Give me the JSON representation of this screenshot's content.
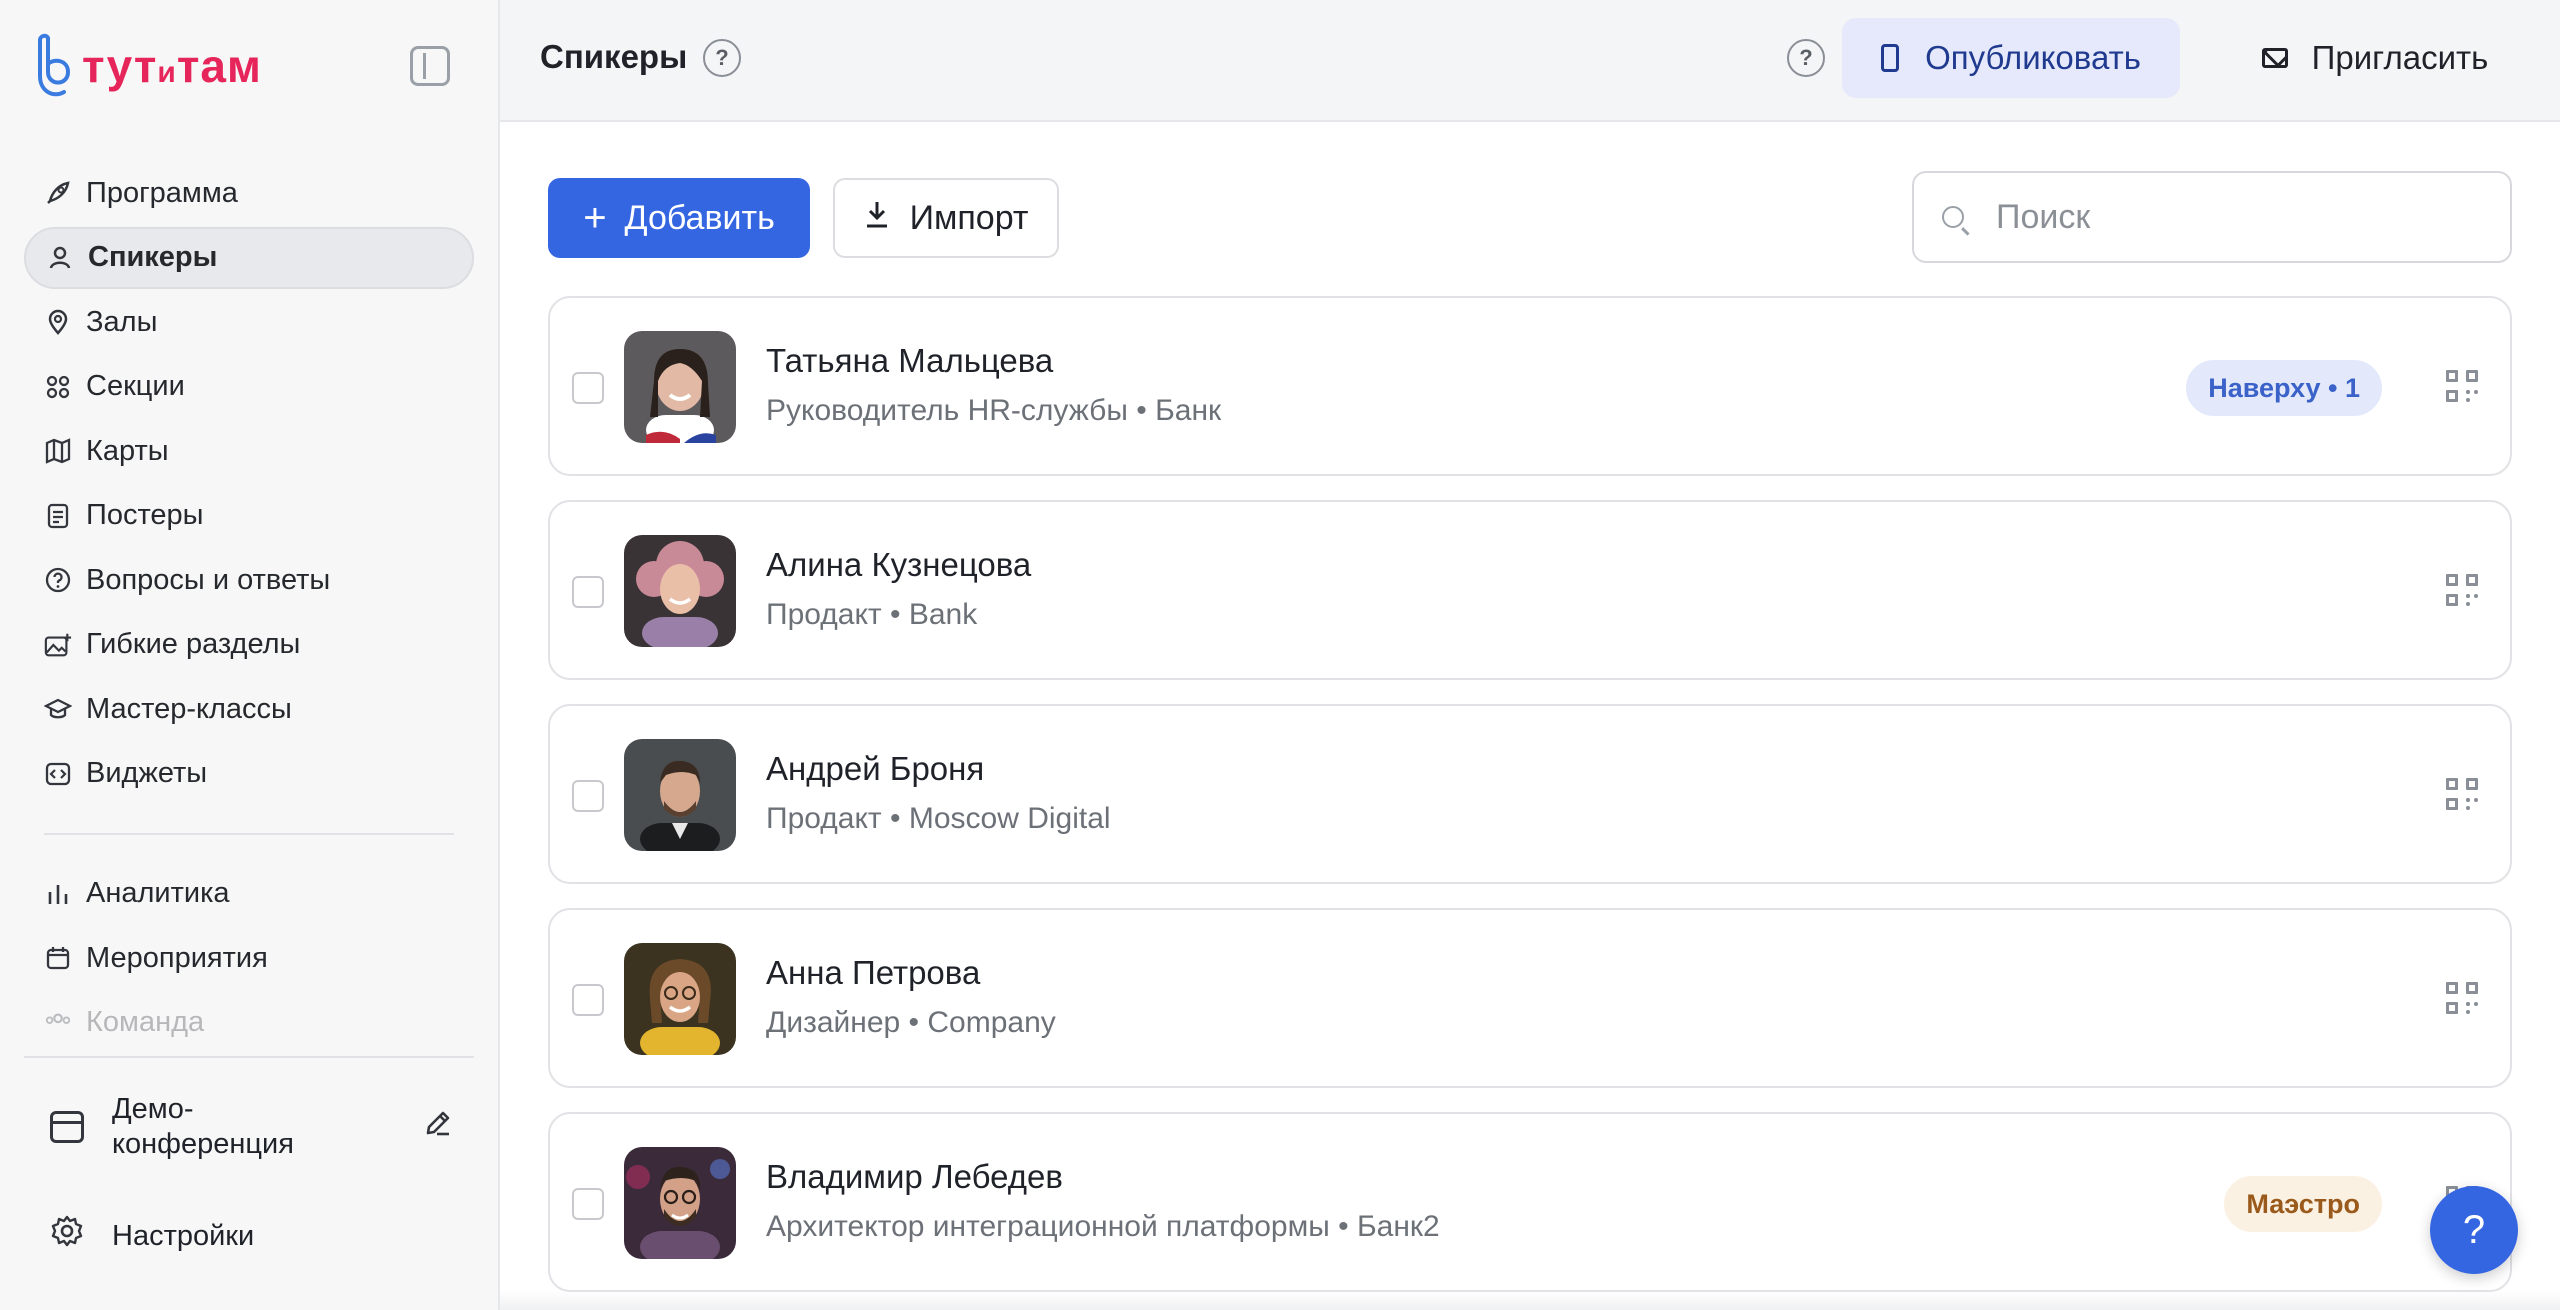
{
  "app": {
    "logo_text_main": "тут",
    "logo_text_small": "и",
    "logo_text_end": "там",
    "brand_color": "#e6265a",
    "accent_color": "#3566e2"
  },
  "sidebar": {
    "items": [
      {
        "label": "Программа",
        "icon": "rocket-icon",
        "glyph": "🚀",
        "active": false
      },
      {
        "label": "Спикеры",
        "icon": "user-icon",
        "glyph": "♙",
        "active": true
      },
      {
        "label": "Залы",
        "icon": "map-pin-icon",
        "glyph": "⌖",
        "active": false
      },
      {
        "label": "Секции",
        "icon": "grid-icon",
        "glyph": "⁘",
        "active": false
      },
      {
        "label": "Карты",
        "icon": "map-icon",
        "glyph": "▤",
        "active": false
      },
      {
        "label": "Постеры",
        "icon": "poster-icon",
        "glyph": "▦",
        "active": false
      },
      {
        "label": "Вопросы и ответы",
        "icon": "question-circle-icon",
        "glyph": "?",
        "active": false
      },
      {
        "label": "Гибкие разделы",
        "icon": "image-plus-icon",
        "glyph": "▣",
        "active": false
      },
      {
        "label": "Мастер-классы",
        "icon": "graduation-cap-icon",
        "glyph": "⌂",
        "active": false
      },
      {
        "label": "Виджеты",
        "icon": "code-icon",
        "glyph": "⟨⟩",
        "active": false
      }
    ],
    "secondary_items": [
      {
        "label": "Аналитика",
        "icon": "bar-chart-icon",
        "glyph": "ılı"
      },
      {
        "label": "Мероприятия",
        "icon": "calendar-icon",
        "glyph": "▦"
      },
      {
        "label": "Команда",
        "icon": "team-icon",
        "glyph": "♗"
      }
    ],
    "event_name": "Демо-конференция",
    "settings_label": "Настройки"
  },
  "header": {
    "title": "Спикеры",
    "publish_label": "Опубликовать",
    "invite_label": "Пригласить"
  },
  "toolbar": {
    "add_label": "Добавить",
    "import_label": "Импорт",
    "search_placeholder": "Поиск",
    "search_value": ""
  },
  "speakers": [
    {
      "name": "Татьяна Мальцева",
      "subtitle": "Руководитель HR-службы • Банк",
      "badge": "Наверху • 1",
      "badge_style": "blue",
      "avatar_bg": "#5c5a5d",
      "avatar_skin": "#e2b9a4",
      "avatar_hair": "#2b211c",
      "avatar_cloth": "#ffffff"
    },
    {
      "name": "Алина Кузнецова",
      "subtitle": "Продакт • Bank",
      "badge": "",
      "badge_style": "",
      "avatar_bg": "#3a3336",
      "avatar_skin": "#e9bfa8",
      "avatar_hair": "#c98a98",
      "avatar_cloth": "#9a7fa8"
    },
    {
      "name": "Андрей Броня",
      "subtitle": "Продакт • Moscow Digital",
      "badge": "",
      "badge_style": "",
      "avatar_bg": "#4a4d4f",
      "avatar_skin": "#d6a98f",
      "avatar_hair": "#3a2b22",
      "avatar_cloth": "#1c1d1f"
    },
    {
      "name": "Анна Петрова",
      "subtitle": "Дизайнер • Company",
      "badge": "",
      "badge_style": "",
      "avatar_bg": "#3b3320",
      "avatar_skin": "#d9a585",
      "avatar_hair": "#6b4a2a",
      "avatar_cloth": "#e3b52f"
    },
    {
      "name": "Владимир Лебедев",
      "subtitle": "Архитектор интеграционной платформы • Банк2",
      "badge": "Маэстро",
      "badge_style": "orange",
      "avatar_bg": "#3b2a3a",
      "avatar_skin": "#d2a188",
      "avatar_hair": "#2d231c",
      "avatar_cloth": "#6a4e70"
    }
  ],
  "fab": {
    "label": "?"
  }
}
